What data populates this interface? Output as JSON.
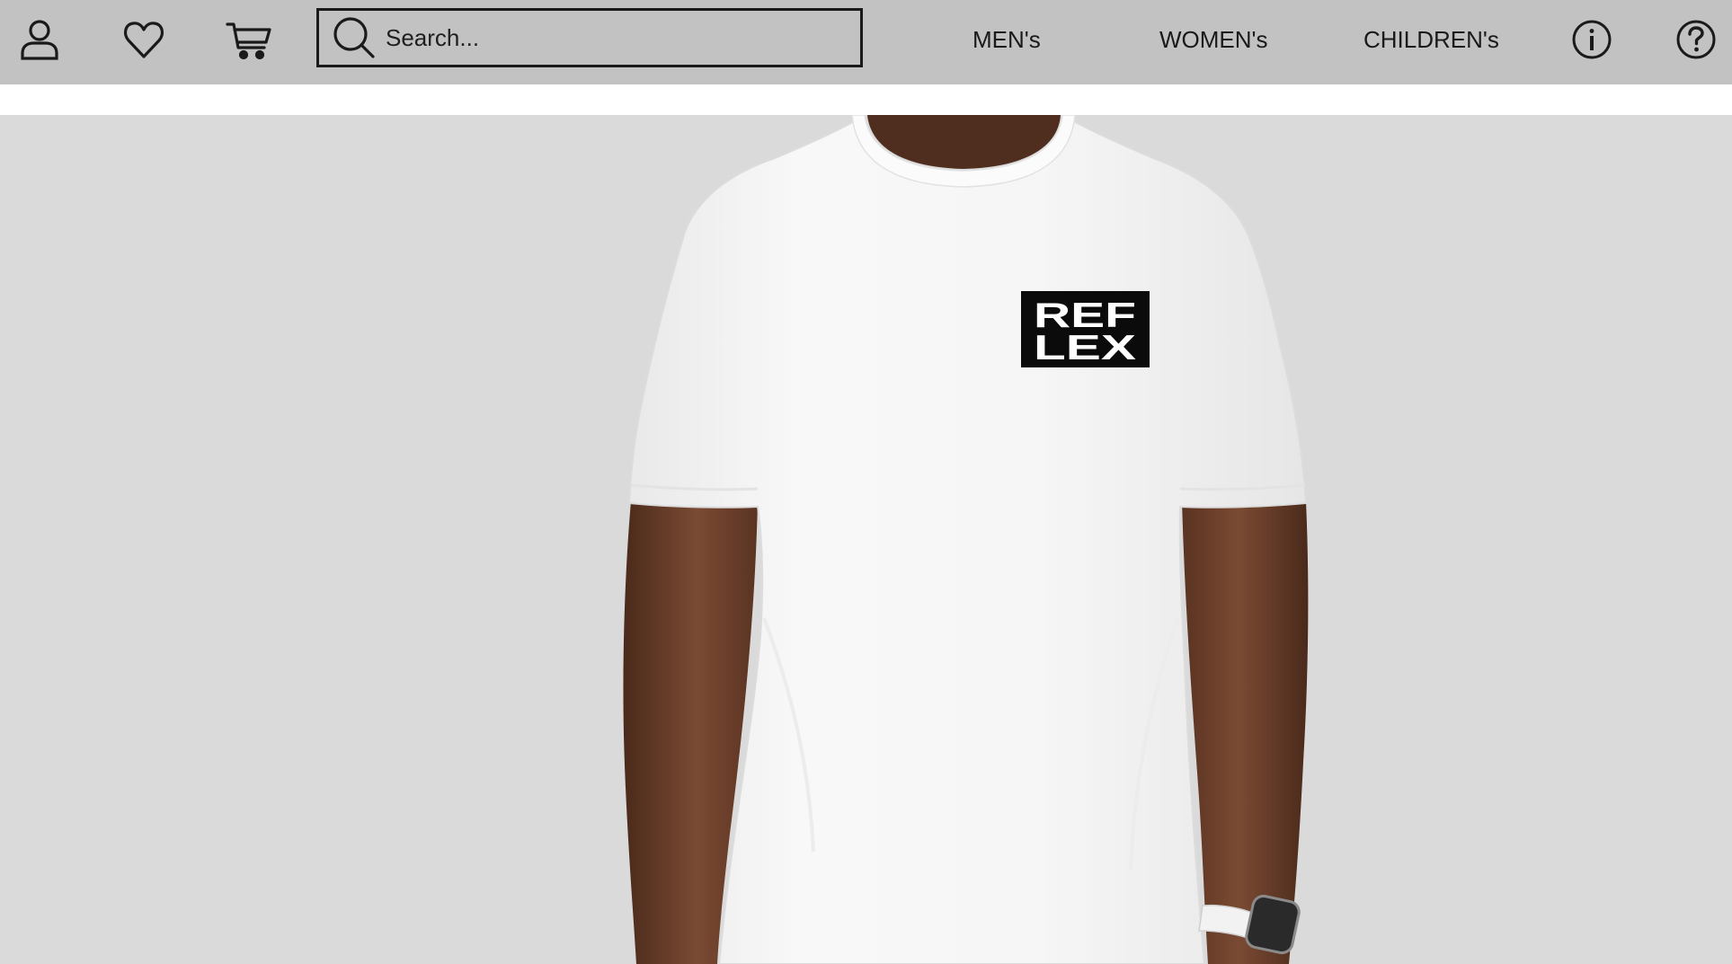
{
  "header": {
    "icons": {
      "account": "user-icon",
      "wishlist": "heart-icon",
      "cart": "cart-icon",
      "info": "info-icon",
      "help": "help-icon",
      "search": "search-icon"
    },
    "search": {
      "placeholder": "Search...",
      "value": ""
    },
    "nav": [
      {
        "label": "MEN's"
      },
      {
        "label": "WOMEN's"
      },
      {
        "label": "CHILDREN's"
      }
    ]
  },
  "hero": {
    "logo": {
      "line1": "REF",
      "line2": "LEX"
    }
  },
  "colors": {
    "header_bg": "#c2c2c2",
    "hero_bg": "#dadada",
    "text": "#1a1a1a",
    "shirt": "#f7f7f7",
    "skin": "#6b3f2a"
  }
}
